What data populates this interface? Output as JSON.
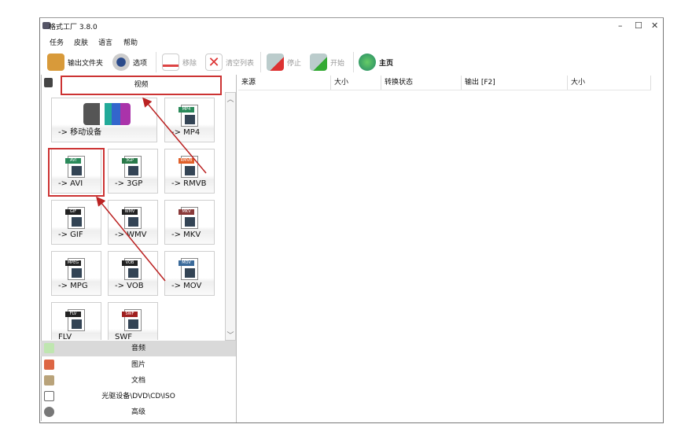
{
  "window": {
    "title": "格式工厂 3.8.0",
    "minimize": "–",
    "maximize": "☐",
    "close": "✕"
  },
  "menu": [
    "任务",
    "皮肤",
    "语言",
    "帮助"
  ],
  "toolbar": {
    "output_folder": "输出文件夹",
    "options": "选项",
    "remove": "移除",
    "clear_list": "清空列表",
    "stop": "停止",
    "start": "开始",
    "home": "主页"
  },
  "left": {
    "video_header": "视频",
    "tiles": [
      {
        "label": "-> 移动设备",
        "tag": ""
      },
      {
        "label": "-> MP4",
        "tag": "MP4",
        "color": "#2a8a5a"
      },
      {
        "label": "-> AVI",
        "tag": "AVI",
        "color": "#2a8a5a"
      },
      {
        "label": "-> 3GP",
        "tag": "3GP",
        "color": "#2a7a4a"
      },
      {
        "label": "-> RMVB",
        "tag": "RMVB",
        "color": "#e0602a"
      },
      {
        "label": "-> GIF",
        "tag": "GIF",
        "color": "#222"
      },
      {
        "label": "-> WMV",
        "tag": "WMV",
        "color": "#222"
      },
      {
        "label": "-> MKV",
        "tag": "MKV",
        "color": "#8a3a3a"
      },
      {
        "label": "-> MPG",
        "tag": "MPEG",
        "color": "#222"
      },
      {
        "label": "-> VOB",
        "tag": "VOB",
        "color": "#222"
      },
      {
        "label": "-> MOV",
        "tag": "MOV",
        "color": "#3a6a9a"
      },
      {
        "label": "FLV",
        "tag": "FLV",
        "color": "#222"
      },
      {
        "label": "SWF",
        "tag": "SWF",
        "color": "#a02020"
      }
    ],
    "categories": [
      "音频",
      "图片",
      "文档",
      "光驱设备\\DVD\\CD\\ISO",
      "高级"
    ]
  },
  "columns": [
    "来源",
    "大小",
    "转换状态",
    "输出 [F2]",
    "大小"
  ]
}
